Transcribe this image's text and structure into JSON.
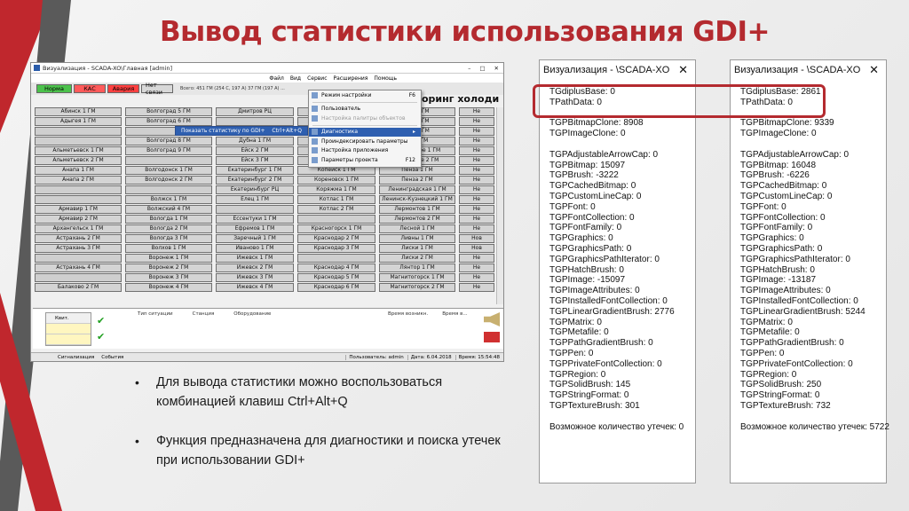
{
  "slide": {
    "title": "Вывод статистики использования GDI+",
    "bullets": [
      "Для вывода статистики можно воспользоваться комбинацией клавиш Ctrl+Alt+Q",
      "Функция предназначена для диагностики и поиска утечек при использовании GDI+"
    ],
    "colors": {
      "accent": "#b42a2f",
      "stripe_gray": "#555555",
      "stripe_red": "#c0272d"
    }
  },
  "scada": {
    "window_title": "Визуализация - SCADA-XO\\Главная [admin]",
    "menu": [
      "Файл",
      "Вид",
      "Сервис",
      "Расширения",
      "Помощь"
    ],
    "toolbar": {
      "norm": "Норма",
      "kas": "КАС",
      "alarm": "Авария",
      "noconn": "Нет связи"
    },
    "stats_text": "Всего: 451 ГМ (254 С, 197 А) 37 ГМ (197 А) ...",
    "big_text": "оринг холоди",
    "grid": [
      [
        "Абинск 1 ГМ",
        "Волгоград 5 ГМ",
        "Дмитров РЦ",
        "",
        "ган 1 ГМ",
        "Не"
      ],
      [
        "Адыгея 1 ГМ",
        "Волгоград 6 ГМ",
        "",
        "",
        "ган 2 ГМ",
        "Не"
      ],
      [
        "",
        "",
        "",
        "",
        "нкт 1 ГМ",
        "Не"
      ],
      [
        "",
        "Волгоград 8 ГМ",
        "Дубна 1 ГМ",
        "",
        "ыт 1 ГМ",
        "Не"
      ],
      [
        "Альметьевск 1 ГМ",
        "Волгоград 9 ГМ",
        "Ейск 2 ГМ",
        "",
        "езеровское 1 ГМ",
        "Не"
      ],
      [
        "Альметьевск 2 ГМ",
        "",
        "Ейск 3 ГМ",
        "",
        "зеровское 2 ГМ",
        "Не"
      ],
      [
        "Анапа 1 ГМ",
        "Волгодонск 1 ГМ",
        "Екатеринбург 1 ГМ",
        "Копейск 1 ГМ",
        "Пенза 1 ГМ",
        "Не"
      ],
      [
        "Анапа 2 ГМ",
        "Волгодонск 2 ГМ",
        "Екатеринбург 2 ГМ",
        "Кореновск 1 ГМ",
        "Пенза 2 ГМ",
        "Не"
      ],
      [
        "",
        "",
        "Екатеринбург РЦ",
        "Коряжма 1 ГМ",
        "Ленинградская 1 ГМ",
        "Не"
      ],
      [
        "",
        "Волжск 1 ГМ",
        "Елец 1 ГМ",
        "Котлас 1 ГМ",
        "Ленинск-Кузнецкий 1 ГМ",
        "Не"
      ],
      [
        "Армавир 1 ГМ",
        "Волжский 4 ГМ",
        "",
        "Котлас 2 ГМ",
        "Лермонтов 1 ГМ",
        "Не"
      ],
      [
        "Армавир 2 ГМ",
        "Вологда 1 ГМ",
        "Ессентуки 1 ГМ",
        "",
        "Лермонтов 2 ГМ",
        "Не"
      ],
      [
        "Архангельск 1 ГМ",
        "Вологда 2 ГМ",
        "Ефремов 1 ГМ",
        "Красногорск 1 ГМ",
        "Лесной 1 ГМ",
        "Не"
      ],
      [
        "Астрахань 2 ГМ",
        "Вологда 3 ГМ",
        "Заречный 1 ГМ",
        "Краснодар 2 ГМ",
        "Ливны 1 ГМ",
        "Нов"
      ],
      [
        "Астрахань 3 ГМ",
        "Волхов 1 ГМ",
        "Иваново 1 ГМ",
        "Краснодар 3 ГМ",
        "Лиски 1 ГМ",
        "Нов"
      ],
      [
        "",
        "Воронеж 1 ГМ",
        "Ижевск 1 ГМ",
        "",
        "Лиски 2 ГМ",
        "Не"
      ],
      [
        "Астрахань 4 ГМ",
        "Воронеж 2 ГМ",
        "Ижевск 2 ГМ",
        "Краснодар 4 ГМ",
        "Лянтор 1 ГМ",
        "Не"
      ],
      [
        "",
        "Воронеж 3 ГМ",
        "Ижевск 3 ГМ",
        "Краснодар 5 ГМ",
        "Магнитогорск 1 ГМ",
        "Не"
      ],
      [
        "Балаково 2 ГМ",
        "Воронеж 4 ГМ",
        "Ижевск 4 ГМ",
        "Краснодар 6 ГМ",
        "Магнитогорск 2 ГМ",
        "Не"
      ]
    ],
    "context_menu": [
      {
        "label": "Режим настройки",
        "shortcut": "F6",
        "state": "normal"
      },
      {
        "label": "",
        "shortcut": "",
        "state": "sep"
      },
      {
        "label": "Пользователь",
        "shortcut": "",
        "state": "normal"
      },
      {
        "label": "Настройка палитры объектов",
        "shortcut": "",
        "state": "disabled"
      },
      {
        "label": "",
        "shortcut": "",
        "state": "sep"
      },
      {
        "label": "Диагностика",
        "shortcut": "▸",
        "state": "highlight"
      },
      {
        "label": "Проиндексировать параметры",
        "shortcut": "",
        "state": "normal"
      },
      {
        "label": "Настройка приложения",
        "shortcut": "",
        "state": "normal"
      },
      {
        "label": "Параметры проекта",
        "shortcut": "F12",
        "state": "normal"
      }
    ],
    "submenu": {
      "label": "Показать статистику по GDI+",
      "shortcut": "Ctrl+Alt+Q"
    },
    "alarms": {
      "left_items": [
        "Квит.",
        "",
        ""
      ],
      "columns": [
        "Тип ситуации",
        "Станция",
        "Оборудование"
      ],
      "columns_right": [
        "Время возникн.",
        "Время в..."
      ]
    },
    "statusbar": {
      "tabs": [
        "Сигнализация",
        "События"
      ],
      "user": "Пользователь: admin",
      "date": "Дата: 6.04.2018",
      "time": "Время: 15:54:48"
    }
  },
  "diag_left": {
    "title": "Визуализация - \\SCADA-XO",
    "lines": [
      "TGdiplusBase: 0",
      "TPathData: 0",
      "",
      "TGPBitmapClone: 8908",
      "TGPImageClone: 0",
      "",
      "TGPAdjustableArrowCap: 0",
      "TGPBitmap: 15097",
      "TGPBrush: -3222",
      "TGPCachedBitmap: 0",
      "TGPCustomLineCap: 0",
      "TGPFont: 0",
      "TGPFontCollection: 0",
      "TGPFontFamily: 0",
      "TGPGraphics: 0",
      "TGPGraphicsPath: 0",
      "TGPGraphicsPathIterator: 0",
      "TGPHatchBrush: 0",
      "TGPImage: -15097",
      "TGPImageAttributes: 0",
      "TGPInstalledFontCollection: 0",
      "TGPLinearGradientBrush: 2776",
      "TGPMatrix: 0",
      "TGPMetafile: 0",
      "TGPPathGradientBrush: 0",
      "TGPPen: 0",
      "TGPPrivateFontCollection: 0",
      "TGPRegion: 0",
      "TGPSolidBrush: 145",
      "TGPStringFormat: 0",
      "TGPTextureBrush: 301",
      "",
      "Возможное количество утечек: 0"
    ]
  },
  "diag_right": {
    "title": "Визуализация - \\SCADA-XO",
    "lines": [
      "TGdiplusBase: 2861",
      "TPathData: 0",
      "",
      "TGPBitmapClone: 9339",
      "TGPImageClone: 0",
      "",
      "TGPAdjustableArrowCap: 0",
      "TGPBitmap: 16048",
      "TGPBrush: -6226",
      "TGPCachedBitmap: 0",
      "TGPCustomLineCap: 0",
      "TGPFont: 0",
      "TGPFontCollection: 0",
      "TGPFontFamily: 0",
      "TGPGraphics: 0",
      "TGPGraphicsPath: 0",
      "TGPGraphicsPathIterator: 0",
      "TGPHatchBrush: 0",
      "TGPImage: -13187",
      "TGPImageAttributes: 0",
      "TGPInstalledFontCollection: 0",
      "TGPLinearGradientBrush: 5244",
      "TGPMatrix: 0",
      "TGPMetafile: 0",
      "TGPPathGradientBrush: 0",
      "TGPPen: 0",
      "TGPPrivateFontCollection: 0",
      "TGPRegion: 0",
      "TGPSolidBrush: 250",
      "TGPStringFormat: 0",
      "TGPTextureBrush: 732",
      "",
      "Возможное количество утечек: 5722"
    ]
  }
}
